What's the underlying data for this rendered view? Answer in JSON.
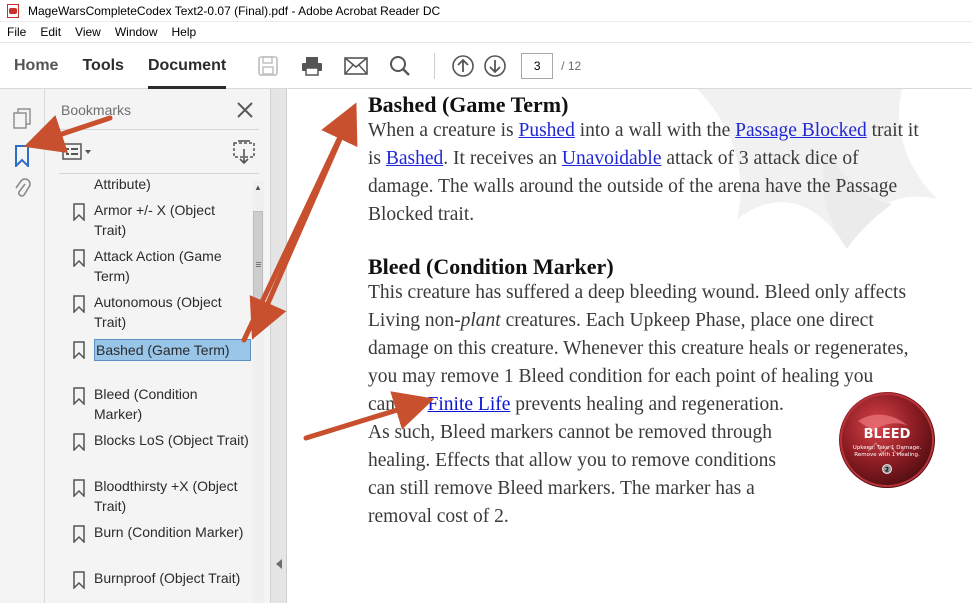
{
  "window": {
    "title": "MageWarsCompleteCodex Text2-0.07 (Final).pdf - Adobe Acrobat Reader DC"
  },
  "menu": [
    "File",
    "Edit",
    "View",
    "Window",
    "Help"
  ],
  "toolbar": {
    "tabs": [
      "Home",
      "Tools",
      "Document"
    ],
    "active_tab": "Document",
    "page_current": "3",
    "page_total": "/ 12",
    "icons": [
      "save-icon",
      "print-icon",
      "mail-icon",
      "search-icon",
      "page-up-icon",
      "page-down-icon"
    ]
  },
  "bookmarks": {
    "title": "Bookmarks",
    "items": [
      "Attribute)",
      "Armor +/- X (Object Trait)",
      "Attack Action (Game Term)",
      "Autonomous (Object Trait)",
      "Bashed (Game Term)",
      "Bleed (Condition Marker)",
      "Blocks LoS (Object Trait)",
      "Bloodthirsty +X (Object Trait)",
      "Burn (Condition Marker)",
      "Burnproof (Object Trait)"
    ],
    "selected": "Bashed (Game Term)"
  },
  "document": {
    "section1": {
      "heading": "Bashed (Game Term)",
      "l1_a": "When a creature is ",
      "l1_link1": "Pushed",
      "l1_b": " into a wall with the ",
      "l1_link2": "Passage Blocked",
      "l1_c": " trait it",
      "l2_a": "is ",
      "l2_link1": "Bashed",
      "l2_b": ". It receives an ",
      "l2_link2": "Unavoidable",
      "l2_c": " attack of 3 attack dice of",
      "l3": "damage. The walls around the outside of the arena have the Passage",
      "l4": "Blocked trait."
    },
    "section2": {
      "heading": "Bleed (Condition Marker)",
      "l1": "This creature has suffered a deep bleeding wound. Bleed only affects",
      "l2_a": "Living non-",
      "l2_em": "plant",
      "l2_b": " creatures. Each Upkeep Phase, place one direct",
      "l3": "damage on this creature. Whenever this creature heals or regenerates,",
      "l4": "you may remove 1 Bleed condition for each point of healing you",
      "l5_a": "cancel. ",
      "l5_link": "Finite Life",
      "l5_b": " prevents healing and regeneration.",
      "l6": "As such, Bleed markers cannot be removed through",
      "l7": "healing. Effects that allow you to remove conditions",
      "l8": "can still remove Bleed markers. The marker has a",
      "l9": "removal cost of 2."
    },
    "token": {
      "title": "BLEED",
      "text1": "Upkeep: Take 1 Damage.",
      "text2": "Remove with 1 Healing.",
      "cost": "2"
    }
  },
  "colors": {
    "link": "#1f27d6",
    "selection": "#99c5e8",
    "annotation_arrow": "#c8502e"
  }
}
